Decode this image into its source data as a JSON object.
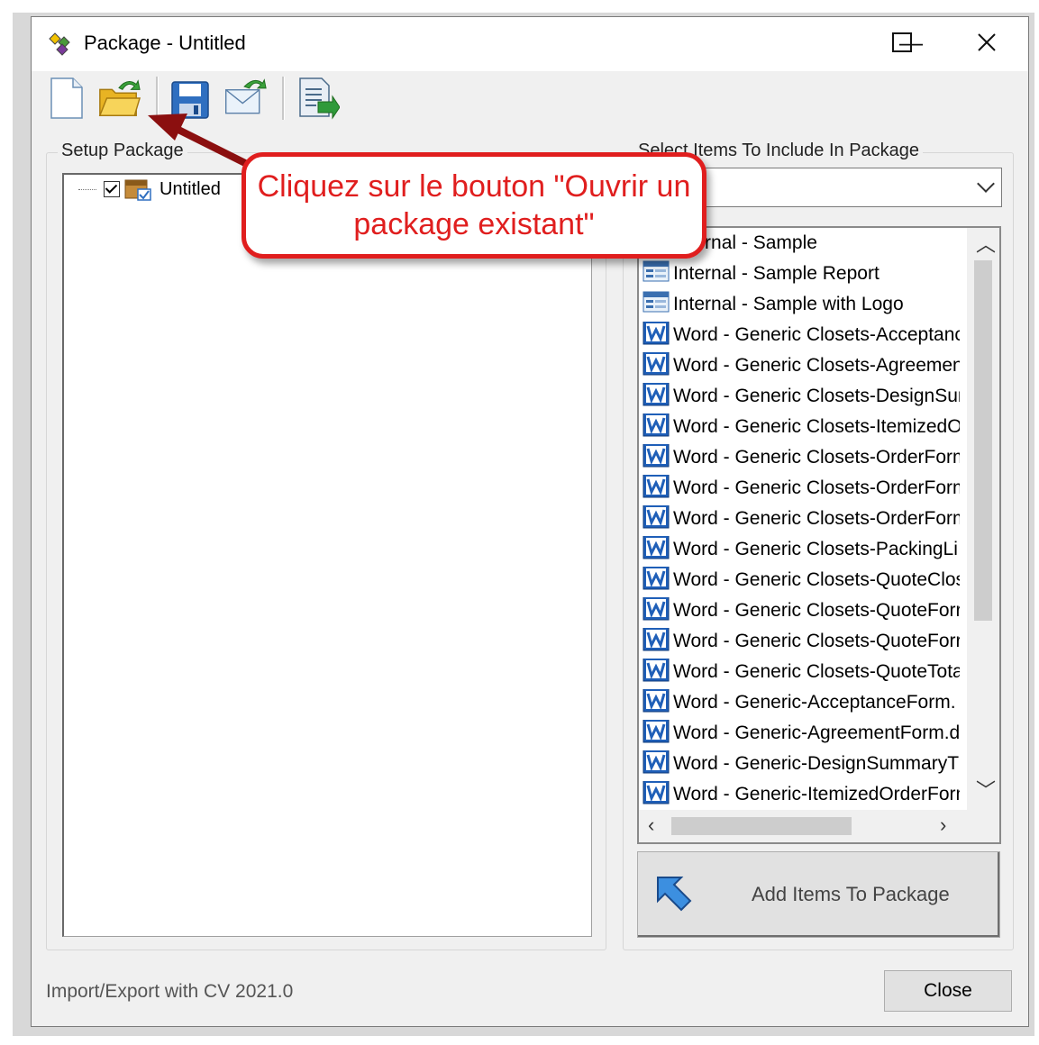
{
  "window": {
    "title": "Package - Untitled",
    "minimize": "—",
    "maximize": "☐",
    "close": "✕"
  },
  "toolbar": {
    "buttons": [
      "new-package",
      "open-package",
      "save-package",
      "email-package",
      "export-package"
    ]
  },
  "setup_group": {
    "label": "Setup Package",
    "tree_root": {
      "label": "Untitled",
      "checked": true
    }
  },
  "select_group": {
    "label": "Select Items To Include In Package",
    "combo_value": "",
    "items": [
      {
        "icon": "report-icon",
        "label": "Internal - Sample"
      },
      {
        "icon": "report-icon",
        "label": "Internal - Sample Report"
      },
      {
        "icon": "report-icon",
        "label": "Internal - Sample with Logo"
      },
      {
        "icon": "word-icon",
        "label": "Word - Generic Closets-Acceptanc"
      },
      {
        "icon": "word-icon",
        "label": "Word - Generic Closets-Agreemen"
      },
      {
        "icon": "word-icon",
        "label": "Word - Generic Closets-DesignSur"
      },
      {
        "icon": "word-icon",
        "label": "Word - Generic Closets-ItemizedO"
      },
      {
        "icon": "word-icon",
        "label": "Word - Generic Closets-OrderForm"
      },
      {
        "icon": "word-icon",
        "label": "Word - Generic Closets-OrderForm"
      },
      {
        "icon": "word-icon",
        "label": "Word - Generic Closets-OrderForm"
      },
      {
        "icon": "word-icon",
        "label": "Word - Generic Closets-PackingLi"
      },
      {
        "icon": "word-icon",
        "label": "Word - Generic Closets-QuoteClos"
      },
      {
        "icon": "word-icon",
        "label": "Word - Generic Closets-QuoteForr"
      },
      {
        "icon": "word-icon",
        "label": "Word - Generic Closets-QuoteForr"
      },
      {
        "icon": "word-icon",
        "label": "Word - Generic Closets-QuoteTota"
      },
      {
        "icon": "word-icon",
        "label": "Word - Generic-AcceptanceForm."
      },
      {
        "icon": "word-icon",
        "label": "Word - Generic-AgreementForm.d"
      },
      {
        "icon": "word-icon",
        "label": "Word - Generic-DesignSummaryT"
      },
      {
        "icon": "word-icon",
        "label": "Word - Generic-ItemizedOrderForn"
      }
    ],
    "add_button": "Add Items To Package"
  },
  "footer": {
    "status": "Import/Export with CV 2021.0",
    "close_button": "Close"
  },
  "annotation": {
    "callout_text": "Cliquez sur le bouton \"Ouvrir un package existant\"",
    "color": "#e01e1e"
  }
}
